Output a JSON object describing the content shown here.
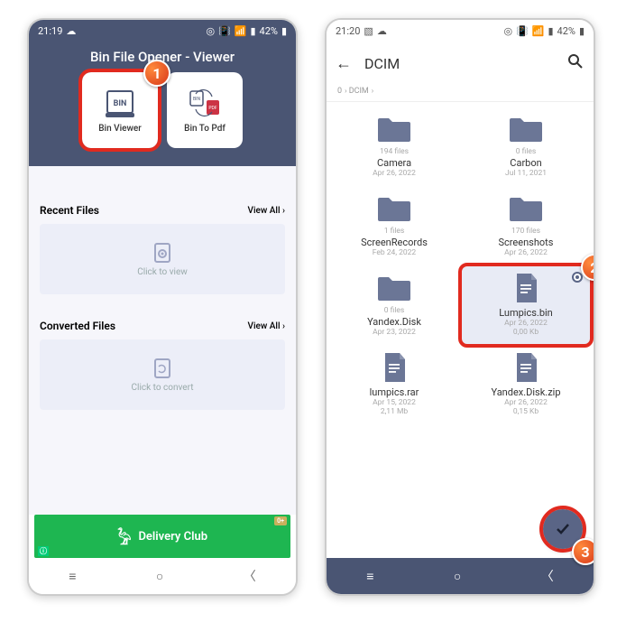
{
  "screen1": {
    "status": {
      "time": "21:19",
      "battery": "42%"
    },
    "title": "Bin File Opener - Viewer",
    "options": [
      {
        "label": "Bin Viewer"
      },
      {
        "label": "Bin To Pdf"
      }
    ],
    "recent": {
      "title": "Recent Files",
      "view_all": "View All",
      "placeholder": "Click to view"
    },
    "converted": {
      "title": "Converted Files",
      "view_all": "View All",
      "placeholder": "Click to convert"
    },
    "ad": {
      "label": "Delivery Club",
      "tag": "0+"
    }
  },
  "screen2": {
    "status": {
      "time": "21:20",
      "battery": "42%"
    },
    "header": {
      "title": "DCIM"
    },
    "breadcrumb": {
      "root": "0",
      "folder": "DCIM"
    },
    "items": [
      {
        "type": "folder",
        "count": "194 files",
        "name": "Camera",
        "date": "Apr 26, 2022"
      },
      {
        "type": "folder",
        "count": "0 files",
        "name": "Carbon",
        "date": "Jul 11, 2021"
      },
      {
        "type": "folder",
        "count": "1 files",
        "name": "ScreenRecords",
        "date": "Feb 24, 2022"
      },
      {
        "type": "folder",
        "count": "170 files",
        "name": "Screenshots",
        "date": "Apr 26, 2022"
      },
      {
        "type": "folder",
        "count": "0 files",
        "name": "Yandex.Disk",
        "date": "Apr 23, 2022"
      },
      {
        "type": "file",
        "name": "Lumpics.bin",
        "date": "Apr 26, 2022",
        "size": "0,00 Kb",
        "selected": true
      },
      {
        "type": "file",
        "name": "lumpics.rar",
        "date": "Apr 15, 2022",
        "size": "2,11 Mb"
      },
      {
        "type": "file",
        "name": "Yandex.Disk.zip",
        "date": "Apr 26, 2022",
        "size": "0,15 Kb"
      }
    ]
  },
  "badges": {
    "one": "1",
    "two": "2",
    "three": "3"
  }
}
